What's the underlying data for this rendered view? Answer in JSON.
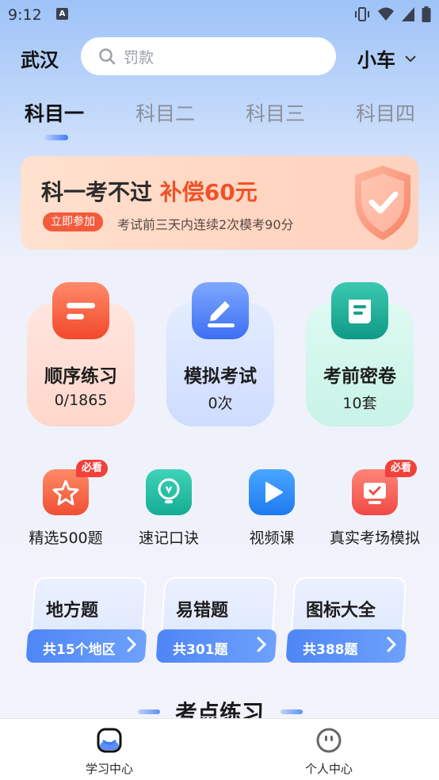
{
  "status_bar": {
    "time": "9:12",
    "notification_glyph": "A"
  },
  "header": {
    "city": "武汉",
    "search_placeholder": "罚款",
    "vehicle": "小车"
  },
  "tabs": [
    {
      "label": "科目一",
      "active": true
    },
    {
      "label": "科目二",
      "active": false
    },
    {
      "label": "科目三",
      "active": false
    },
    {
      "label": "科目四",
      "active": false
    }
  ],
  "banner": {
    "title_plain": "科一考不过",
    "title_highlight": "补偿60元",
    "button": "立即参加",
    "description": "考试前三天内连续2次模考90分"
  },
  "main_cards": [
    {
      "title": "顺序练习",
      "value": "0/1865",
      "icon": "list-icon"
    },
    {
      "title": "模拟考试",
      "value": "0次",
      "icon": "pencil-icon"
    },
    {
      "title": "考前密卷",
      "value": "10套",
      "icon": "scroll-icon"
    }
  ],
  "shortcuts": [
    {
      "label": "精选500题",
      "badge": "必看",
      "icon": "star-icon"
    },
    {
      "label": "速记口诀",
      "badge": "",
      "icon": "lightbulb-icon"
    },
    {
      "label": "视频课",
      "badge": "",
      "icon": "play-icon"
    },
    {
      "label": "真实考场模拟",
      "badge": "必看",
      "icon": "monitor-icon"
    }
  ],
  "categories": [
    {
      "title": "地方题",
      "footer": "共15个地区"
    },
    {
      "title": "易错题",
      "footer": "共301题"
    },
    {
      "title": "图标大全",
      "footer": "共388题"
    }
  ],
  "section": {
    "title": "考点练习"
  },
  "bottom_nav": [
    {
      "label": "学习中心",
      "active": true
    },
    {
      "label": "个人中心",
      "active": false
    }
  ],
  "colors": {
    "accent": "#3f7bf5",
    "highlight": "#f05228",
    "badge": "#f0413a"
  }
}
